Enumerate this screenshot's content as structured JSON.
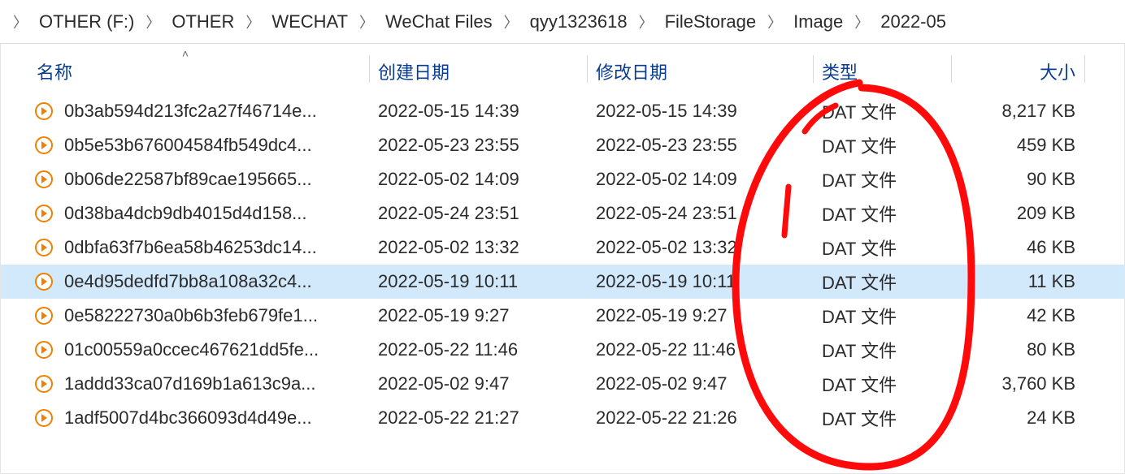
{
  "breadcrumb": {
    "items": [
      {
        "label": "OTHER (F:)"
      },
      {
        "label": "OTHER"
      },
      {
        "label": "WECHAT"
      },
      {
        "label": "WeChat Files"
      },
      {
        "label": "qyy1323618"
      },
      {
        "label": "FileStorage"
      },
      {
        "label": "Image"
      },
      {
        "label": "2022-05"
      }
    ]
  },
  "columns": {
    "name": "名称",
    "created": "创建日期",
    "modified": "修改日期",
    "type": "类型",
    "size": "大小",
    "sort": {
      "column": "name",
      "direction": "asc"
    }
  },
  "files": [
    {
      "icon": "dat-file-icon",
      "name": "0b3ab594d213fc2a27f46714e...",
      "created": "2022-05-15 14:39",
      "modified": "2022-05-15 14:39",
      "type": "DAT 文件",
      "size": "8,217 KB",
      "selected": false
    },
    {
      "icon": "dat-file-icon",
      "name": "0b5e53b676004584fb549dc4...",
      "created": "2022-05-23 23:55",
      "modified": "2022-05-23 23:55",
      "type": "DAT 文件",
      "size": "459 KB",
      "selected": false
    },
    {
      "icon": "dat-file-icon",
      "name": "0b06de22587bf89cae195665...",
      "created": "2022-05-02 14:09",
      "modified": "2022-05-02 14:09",
      "type": "DAT 文件",
      "size": "90 KB",
      "selected": false
    },
    {
      "icon": "dat-file-icon",
      "name": "0d38ba4dcb9db4015d4d158...",
      "created": "2022-05-24 23:51",
      "modified": "2022-05-24 23:51",
      "type": "DAT 文件",
      "size": "209 KB",
      "selected": false
    },
    {
      "icon": "dat-file-icon",
      "name": "0dbfa63f7b6ea58b46253dc14...",
      "created": "2022-05-02 13:32",
      "modified": "2022-05-02 13:32",
      "type": "DAT 文件",
      "size": "46 KB",
      "selected": false
    },
    {
      "icon": "dat-file-icon",
      "name": "0e4d95dedfd7bb8a108a32c4...",
      "created": "2022-05-19 10:11",
      "modified": "2022-05-19 10:11",
      "type": "DAT 文件",
      "size": "11 KB",
      "selected": true
    },
    {
      "icon": "dat-file-icon",
      "name": "0e58222730a0b6b3feb679fe1...",
      "created": "2022-05-19 9:27",
      "modified": "2022-05-19 9:27",
      "type": "DAT 文件",
      "size": "42 KB",
      "selected": false
    },
    {
      "icon": "dat-file-icon",
      "name": "01c00559a0ccec467621dd5fe...",
      "created": "2022-05-22 11:46",
      "modified": "2022-05-22 11:46",
      "type": "DAT 文件",
      "size": "80 KB",
      "selected": false
    },
    {
      "icon": "dat-file-icon",
      "name": "1addd33ca07d169b1a613c9a...",
      "created": "2022-05-02 9:47",
      "modified": "2022-05-02 9:47",
      "type": "DAT 文件",
      "size": "3,760 KB",
      "selected": false
    },
    {
      "icon": "dat-file-icon",
      "name": "1adf5007d4bc366093d4d49e...",
      "created": "2022-05-22 21:27",
      "modified": "2022-05-22 21:26",
      "type": "DAT 文件",
      "size": "24 KB",
      "selected": false
    }
  ],
  "annotation": {
    "description": "hand-drawn red circle around the 类型 (type) column",
    "color": "#ff0000"
  }
}
